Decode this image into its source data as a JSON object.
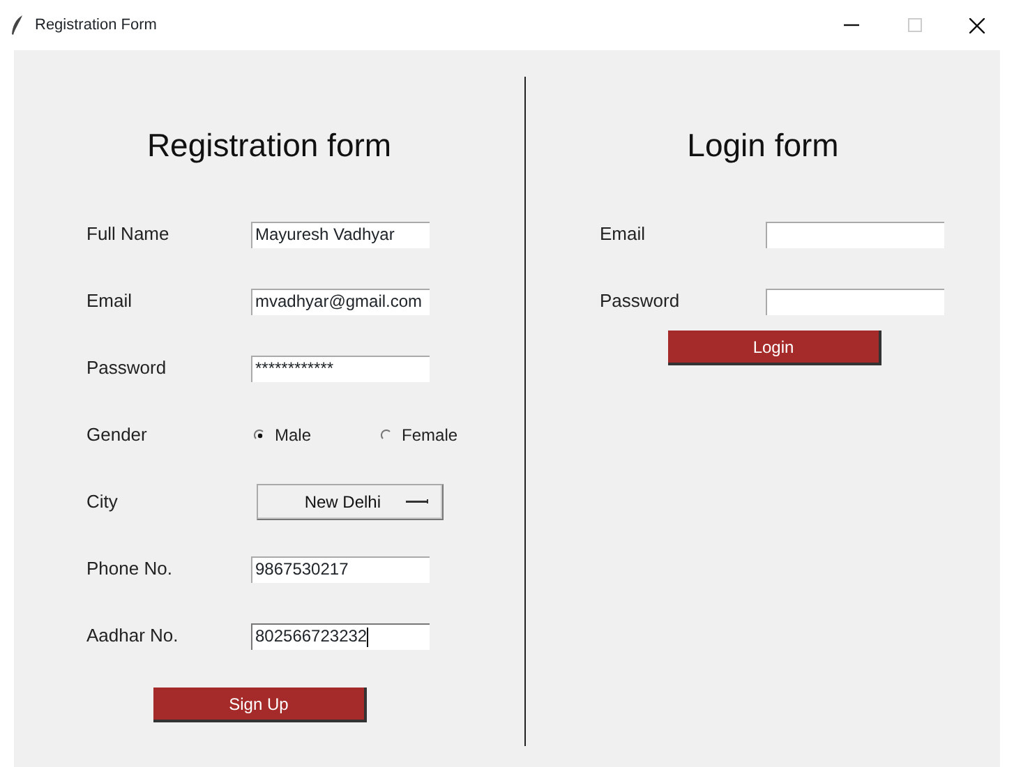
{
  "window": {
    "title": "Registration Form"
  },
  "registration": {
    "title": "Registration form",
    "fields": [
      {
        "kind": "text",
        "label": "Full Name",
        "value": "Mayuresh Vadhyar",
        "focused": false
      },
      {
        "kind": "text",
        "label": "Email",
        "value": "mvadhyar@gmail.com",
        "focused": false
      },
      {
        "kind": "text",
        "label": "Password",
        "value": "************",
        "focused": false
      },
      {
        "kind": "radio",
        "label": "Gender",
        "options": [
          {
            "label": "Male",
            "selected": true
          },
          {
            "label": "Female",
            "selected": false
          }
        ]
      },
      {
        "kind": "dropdown",
        "label": "City",
        "value": "New Delhi"
      },
      {
        "kind": "text",
        "label": "Phone No.",
        "value": "9867530217",
        "focused": false
      },
      {
        "kind": "text",
        "label": "Aadhar No.",
        "value": "802566723232",
        "focused": true
      }
    ],
    "button": "Sign Up"
  },
  "login": {
    "title": "Login form",
    "fields": [
      {
        "kind": "text",
        "label": "Email",
        "focused": false
      },
      {
        "kind": "text",
        "label": "Password",
        "focused": false
      }
    ],
    "button": "Login"
  }
}
